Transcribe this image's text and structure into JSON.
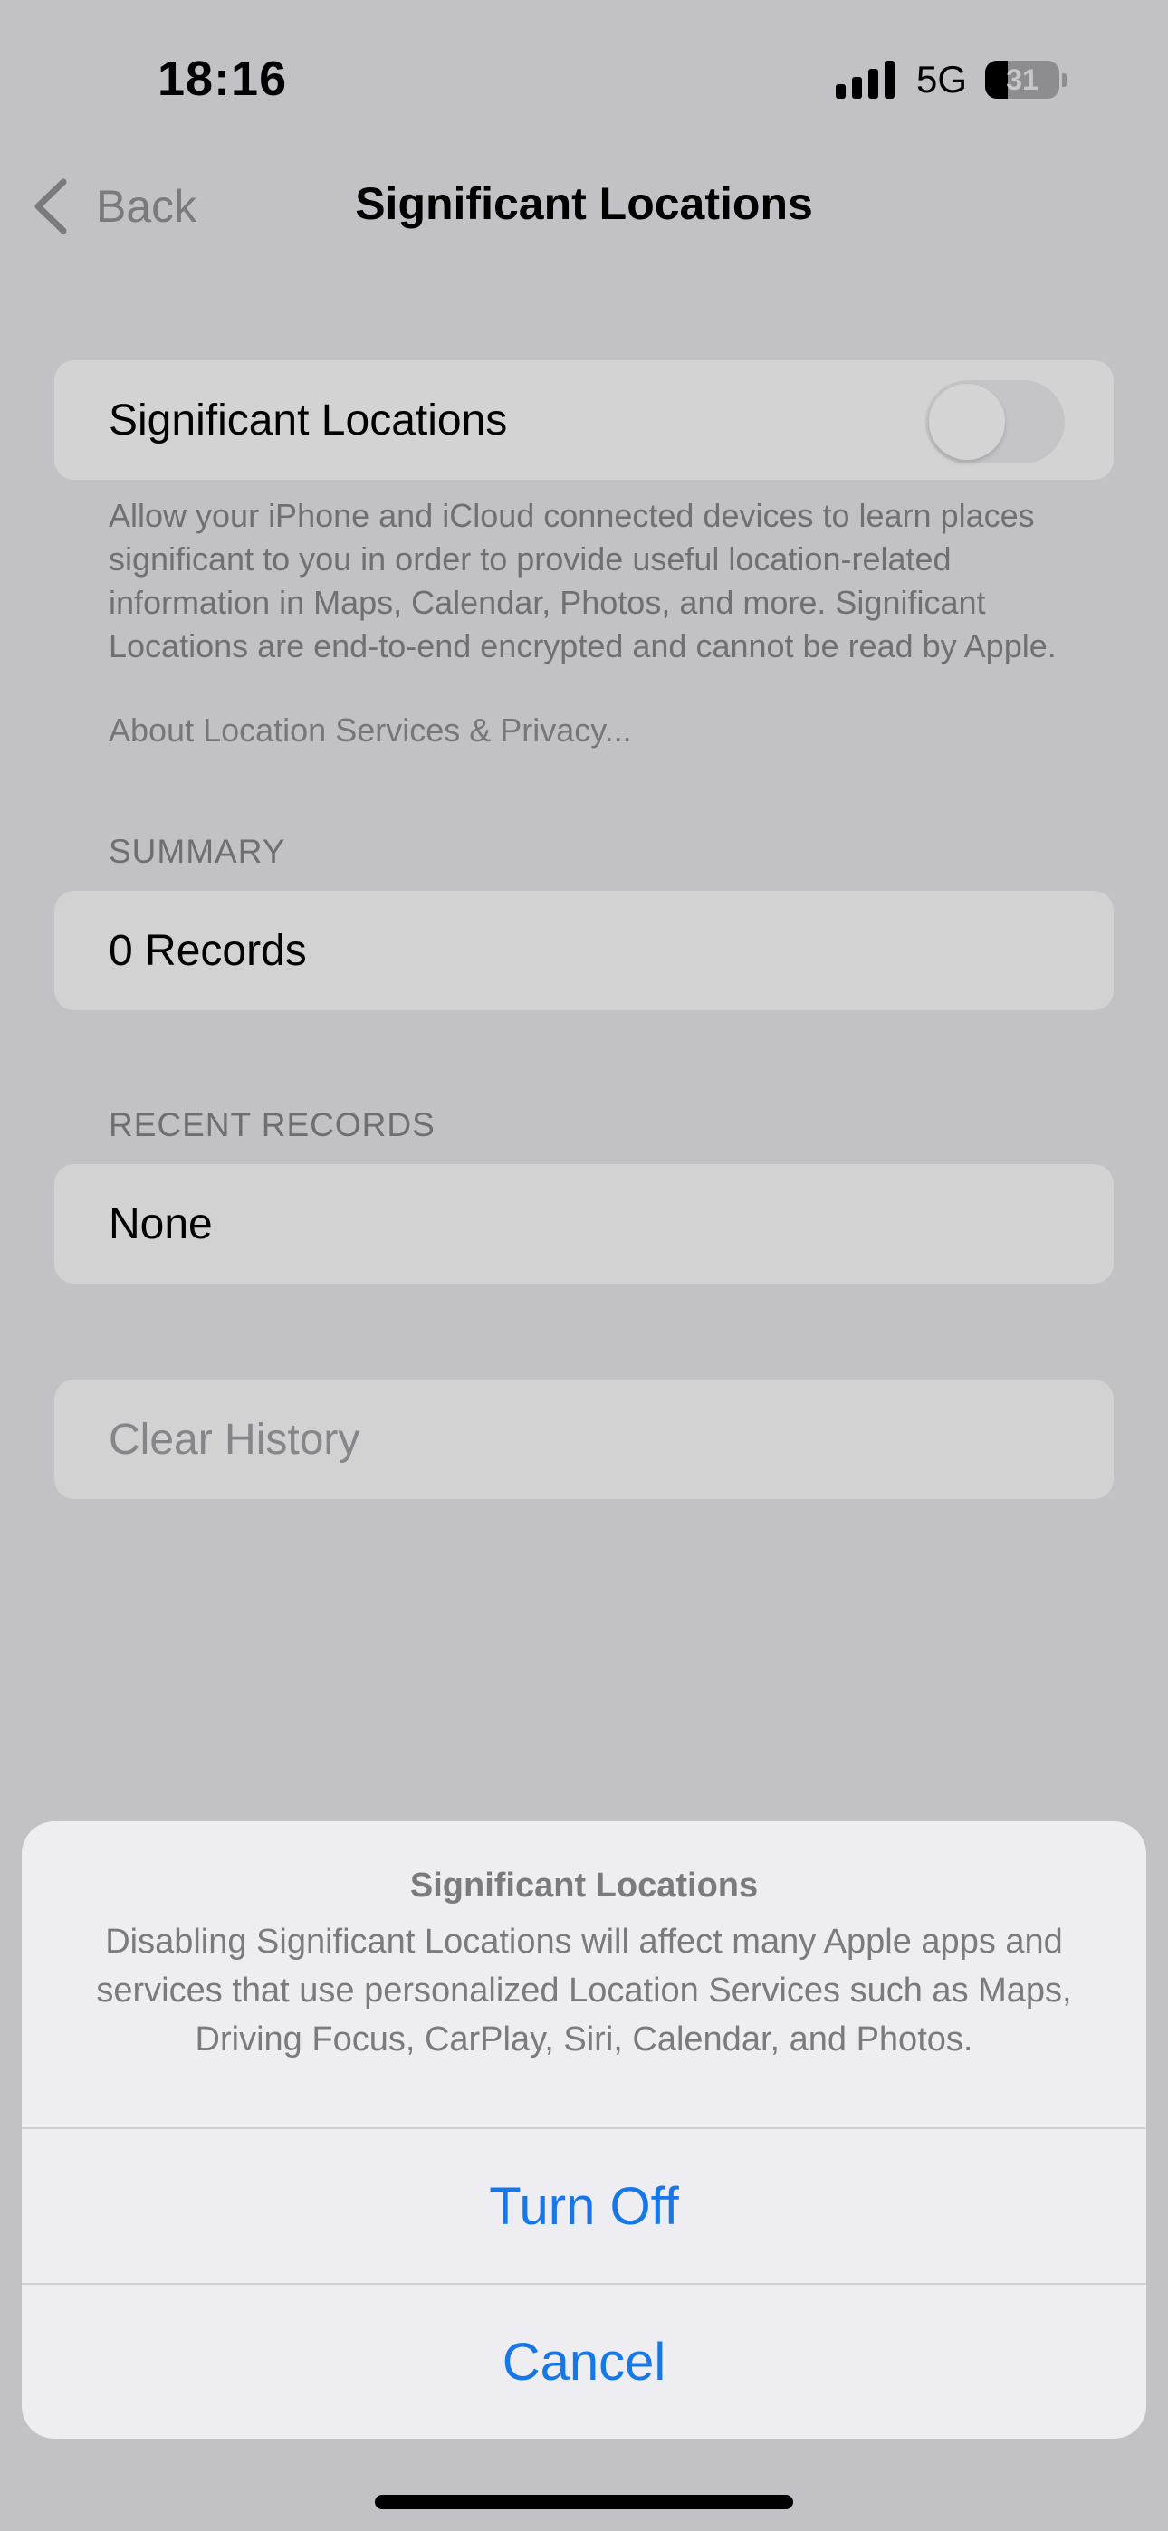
{
  "status_bar": {
    "time": "18:16",
    "network": "5G",
    "battery_level": "31"
  },
  "nav": {
    "back_label": "Back",
    "title": "Significant Locations"
  },
  "toggle_cell": {
    "label": "Significant Locations",
    "enabled": false
  },
  "footer": {
    "description": "Allow your iPhone and iCloud connected devices to learn places significant to you in order to provide useful location-related information in Maps, Calendar, Photos, and more. Significant Locations are end-to-end encrypted and cannot be read by Apple.",
    "link": "About Location Services & Privacy..."
  },
  "summary": {
    "header": "SUMMARY",
    "value": "0 Records"
  },
  "recent": {
    "header": "RECENT RECORDS",
    "value": "None"
  },
  "clear_history": {
    "label": "Clear History"
  },
  "action_sheet": {
    "title": "Significant Locations",
    "message": "Disabling Significant Locations will affect many Apple apps and services that use personalized Location Services such as Maps, Driving Focus, CarPlay, Siri, Calendar, and Photos.",
    "turn_off_label": "Turn Off",
    "cancel_label": "Cancel"
  },
  "colors": {
    "accent": "#1877e6",
    "background_dimmed": "#c2c1c6",
    "sheet_background": "#eeedf2"
  },
  "icons": {
    "back": "chevron-left-icon",
    "signal": "cellular-signal-icon",
    "battery": "battery-icon"
  }
}
